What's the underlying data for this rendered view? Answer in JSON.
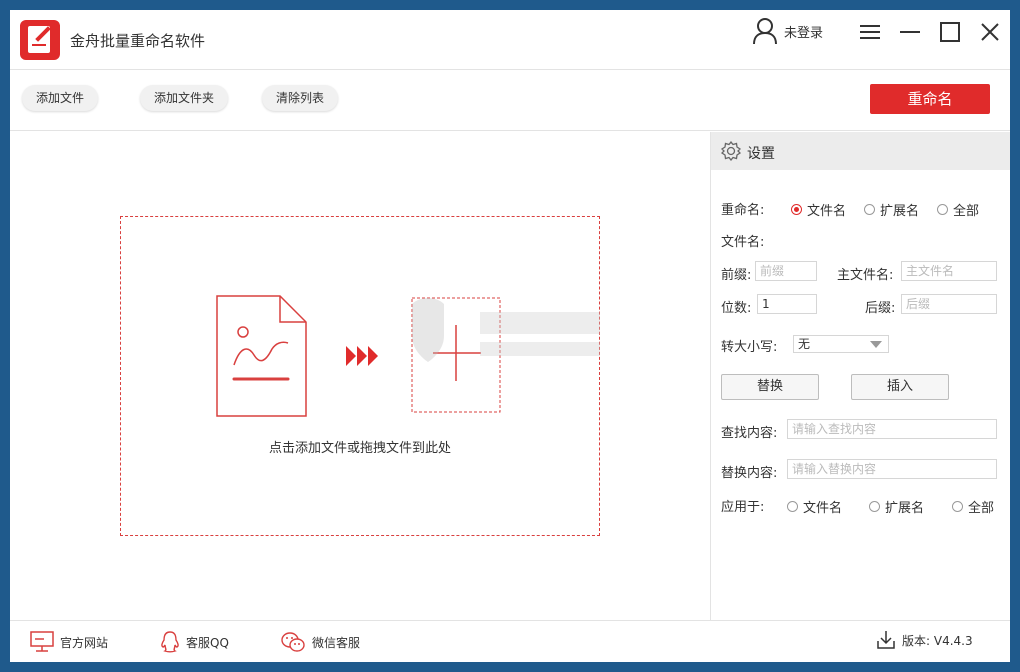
{
  "app": {
    "title": "金舟批量重命名软件"
  },
  "user": {
    "status": "未登录"
  },
  "toolbar": {
    "add_file": "添加文件",
    "add_folder": "添加文件夹",
    "clear_list": "清除列表",
    "rename": "重命名"
  },
  "main": {
    "drop_hint": "点击添加文件或拖拽文件到此处"
  },
  "settings": {
    "title": "设置",
    "rename_label": "重命名:",
    "rename_options": [
      "文件名",
      "扩展名",
      "全部"
    ],
    "rename_selected": "文件名",
    "filename_label": "文件名:",
    "prefix_label": "前缀:",
    "prefix_placeholder": "前缀",
    "main_name_label": "主文件名:",
    "main_name_placeholder": "主文件名",
    "digits_label": "位数:",
    "digits_value": "1",
    "suffix_label": "后缀:",
    "suffix_placeholder": "后缀",
    "case_label": "转大小写:",
    "case_value": "无",
    "replace_btn": "替换",
    "insert_btn": "插入",
    "find_label": "查找内容:",
    "find_placeholder": "请输入查找内容",
    "replace_label": "替换内容:",
    "replace_placeholder": "请输入替换内容",
    "apply_label": "应用于:",
    "apply_options": [
      "文件名",
      "扩展名",
      "全部"
    ]
  },
  "footer": {
    "website": "官方网站",
    "qq": "客服QQ",
    "wechat": "微信客服",
    "version": "版本: V4.4.3"
  },
  "colors": {
    "accent": "#e02b2b",
    "border": "#e3e3e3"
  }
}
